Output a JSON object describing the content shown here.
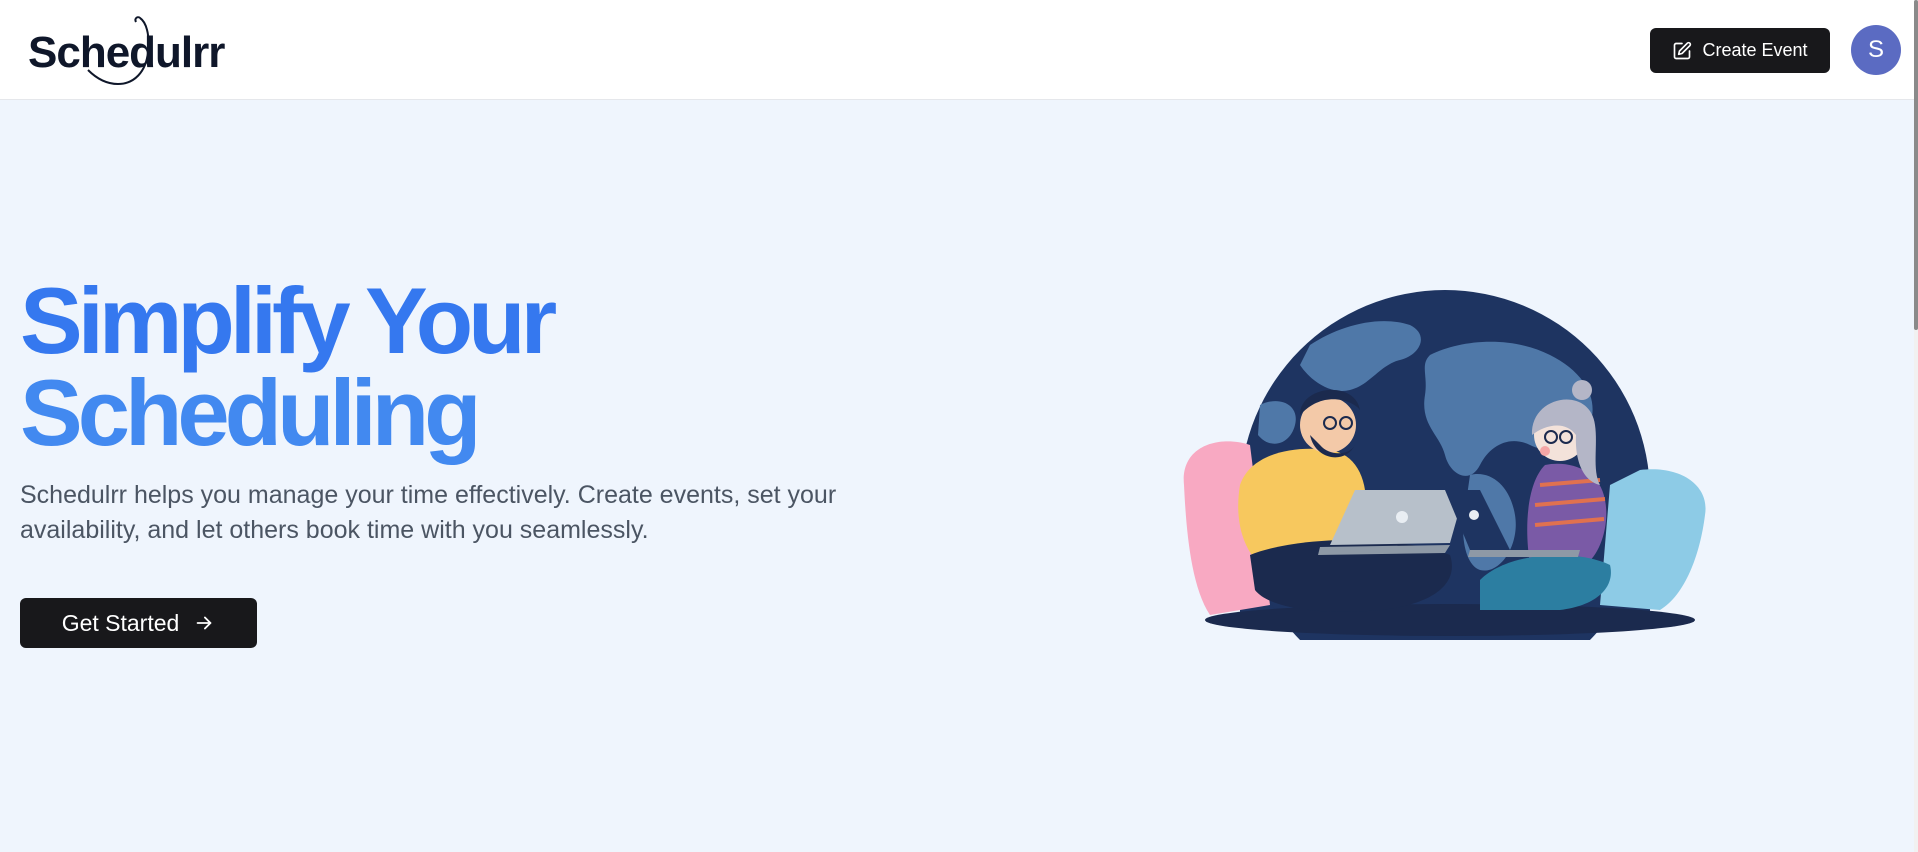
{
  "header": {
    "logo_text": "Schedulrr",
    "create_event_label": "Create Event",
    "avatar_initial": "S"
  },
  "hero": {
    "title_line1": "Simplify Your",
    "title_line2": "Scheduling",
    "description": "Schedulrr helps you manage your time effectively. Create events, set your availability, and let others book time with you seamlessly.",
    "cta_label": "Get Started"
  },
  "icons": {
    "create_event": "pen-square-icon",
    "cta": "arrow-right-icon"
  },
  "colors": {
    "accent": "#3b82f6",
    "button_bg": "#18181b",
    "avatar_bg": "#5b6bc2",
    "page_bg": "#eff5fd"
  }
}
